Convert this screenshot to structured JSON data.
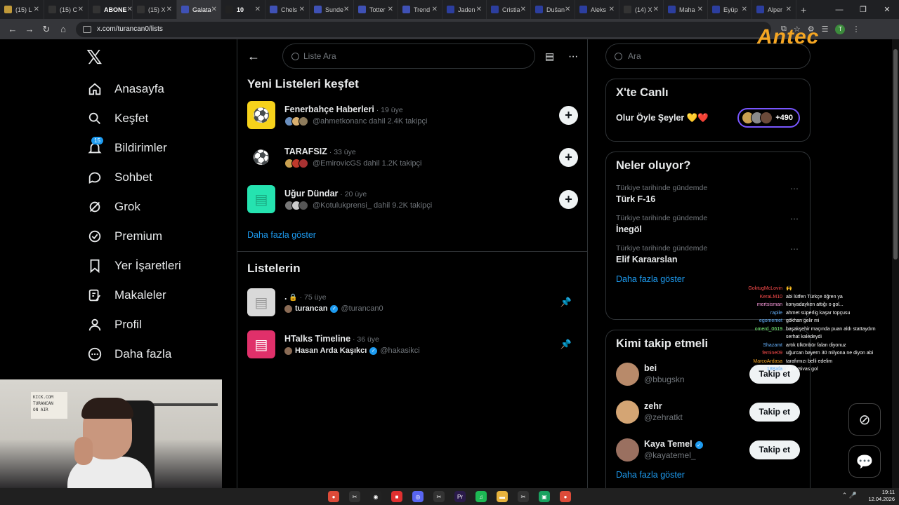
{
  "browser": {
    "tabs": [
      {
        "label": "(15) L",
        "color": "#c19a3a"
      },
      {
        "label": "(15) C",
        "color": "#333333"
      },
      {
        "label": "ABONE",
        "color": "#333333",
        "bold": true
      },
      {
        "label": "(15) X",
        "color": "#333333"
      },
      {
        "label": "Galata",
        "color": "#3f51b5"
      },
      {
        "label": "10",
        "color": "#222222",
        "bold": true
      },
      {
        "label": "Chels",
        "color": "#3f51b5"
      },
      {
        "label": "Sunde",
        "color": "#3f51b5"
      },
      {
        "label": "Totter",
        "color": "#3f51b5"
      },
      {
        "label": "Trend",
        "color": "#3f51b5"
      },
      {
        "label": "Jaden",
        "color": "#2c3e9e"
      },
      {
        "label": "Cristia",
        "color": "#2c3e9e"
      },
      {
        "label": "Dušan",
        "color": "#2c3e9e"
      },
      {
        "label": "Aleks",
        "color": "#2c3e9e"
      },
      {
        "label": "(14) X",
        "color": "#333333"
      },
      {
        "label": "Maha",
        "color": "#2c3e9e"
      },
      {
        "label": "Eyüp",
        "color": "#2c3e9e"
      },
      {
        "label": "Alper",
        "color": "#2c3e9e"
      }
    ],
    "url": "x.com/turancan0/lists"
  },
  "nav": {
    "items": [
      {
        "label": "Anasayfa",
        "icon": "home-icon"
      },
      {
        "label": "Keşfet",
        "icon": "search-icon"
      },
      {
        "label": "Bildirimler",
        "icon": "bell-icon",
        "badge": "15"
      },
      {
        "label": "Sohbet",
        "icon": "chat-icon"
      },
      {
        "label": "Grok",
        "icon": "grok-icon"
      },
      {
        "label": "Premium",
        "icon": "premium-icon"
      },
      {
        "label": "Yer İşaretleri",
        "icon": "bookmark-icon"
      },
      {
        "label": "Makaleler",
        "icon": "article-icon"
      },
      {
        "label": "Profil",
        "icon": "profile-icon"
      },
      {
        "label": "Daha fazla",
        "icon": "more-icon"
      }
    ]
  },
  "webcam": {
    "sign_text": "KICK.COM\nTURANCAN\nON AIR"
  },
  "middle": {
    "search_placeholder": "Liste Ara",
    "discover_title": "Yeni Listeleri keşfet",
    "discover": [
      {
        "name": "Fenerbahçe Haberleri",
        "meta": "· 19 üye",
        "follow": "@ahmetkonanc dahil 2.4K takipçi",
        "thumb_bg": "#f6d21b",
        "thumb_glyph": "⚽",
        "avs": [
          "#6a8fbf",
          "#d9b070",
          "#8d7b5c"
        ]
      },
      {
        "name": "TARAFSIZ",
        "meta": "· 33 üye",
        "follow": "@EmirovicGS dahil 1.2K takipçi",
        "thumb_bg": "#000000",
        "thumb_glyph": "⚽",
        "avs": [
          "#c9a050",
          "#c0392b",
          "#a83232"
        ]
      },
      {
        "name": "Uğur Dündar",
        "meta": "· 20 üye",
        "follow": "@Kotulukprensi_ dahil 9.2K takipçi",
        "thumb_bg": "#25e3b0",
        "thumb_glyph": "▤",
        "avs": [
          "#777777",
          "#cccccc",
          "#555555"
        ]
      }
    ],
    "show_more": "Daha fazla göster",
    "your_lists_title": "Listelerin",
    "lists": [
      {
        "name": ".",
        "locked": true,
        "meta": "· 75 üye",
        "owner": "turancan",
        "handle": "@turancan0",
        "thumb_bg": "#d9d9d9",
        "thumb_fg": "#999999"
      },
      {
        "name": "HTalks Timeline",
        "locked": false,
        "meta": "· 36 üye",
        "owner": "Hasan Arda Kaşıkcı",
        "handle": "@hakasikci",
        "thumb_bg": "#e0306a",
        "thumb_fg": "#ffffff"
      }
    ]
  },
  "right": {
    "search_placeholder": "Ara",
    "live_title": "X'te Canlı",
    "live_name": "Olur Öyle Şeyler 💛❤️",
    "live_count": "+490",
    "trends_title": "Neler oluyor?",
    "trends": [
      {
        "context": "Türkiye tarihinde gündemde",
        "name": "Türk F-16"
      },
      {
        "context": "Türkiye tarihinde gündemde",
        "name": "İnegöl"
      },
      {
        "context": "Türkiye tarihinde gündemde",
        "name": "Elif Karaarslan"
      }
    ],
    "trends_more": "Daha fazla göster",
    "who_title": "Kimi takip etmeli",
    "who": [
      {
        "name": "bei",
        "handle": "@bbugskn",
        "verified": false,
        "color": "#b88a6a"
      },
      {
        "name": "zehr",
        "handle": "@zehratkt",
        "verified": false,
        "color": "#d4a574"
      },
      {
        "name": "Kaya Temel",
        "handle": "@kayatemel_",
        "verified": true,
        "color": "#9a7060"
      }
    ],
    "follow_label": "Takip et",
    "who_more": "Daha fazla göster"
  },
  "overlay": {
    "logo": "Antec",
    "chat": [
      {
        "user": "GoktugMcLovin",
        "color": "#ff4d4d",
        "text": "🙌"
      },
      {
        "user": "KeraLM10",
        "color": "#ff4d4d",
        "text": "abi lütfen Türkçe öğren ya"
      },
      {
        "user": "mertsisman",
        "color": "#ff9de0",
        "text": "konyadayken attığı o gol..."
      },
      {
        "user": "rapile",
        "color": "#66b3ff",
        "text": "ahmet süperlig kaşar topçusu"
      },
      {
        "user": "egomemet",
        "color": "#66b3ff",
        "text": "gökhan gelir mi"
      },
      {
        "user": "omerd_0619",
        "color": "#7fff7f",
        "text": "başakşehir maçında puan aldı stattaydım"
      },
      {
        "user": "",
        "color": "#ffffff",
        "text": "serhat kaledeydi"
      },
      {
        "user": "Shazamt",
        "color": "#66b3ff",
        "text": "artık ülkönbür falan diyonuz"
      },
      {
        "user": "femine09",
        "color": "#ff4d4d",
        "text": "uğurcan bayern 30 milyona ne diyon abi"
      },
      {
        "user": "MarcoArdasa",
        "color": "#f5a623",
        "text": "tarafımızı belli edelim"
      },
      {
        "user": "18Bafa",
        "color": "#66b3ff",
        "text": "oğuz Sivas gol"
      }
    ]
  },
  "taskbar": {
    "time": "19:11",
    "date": "12.04.2026",
    "apps": [
      {
        "name": "chrome",
        "color": "#dd4b39",
        "glyph": "●"
      },
      {
        "name": "capcut",
        "color": "#333333",
        "glyph": "✂"
      },
      {
        "name": "obs",
        "color": "#222222",
        "glyph": "◉"
      },
      {
        "name": "stream",
        "color": "#e03030",
        "glyph": "■"
      },
      {
        "name": "discord",
        "color": "#5865f2",
        "glyph": "◎"
      },
      {
        "name": "capcut2",
        "color": "#333333",
        "glyph": "✂"
      },
      {
        "name": "premiere",
        "color": "#2a1a4a",
        "glyph": "Pr"
      },
      {
        "name": "spotify",
        "color": "#1db954",
        "glyph": "♫"
      },
      {
        "name": "explorer",
        "color": "#e8b33d",
        "glyph": "▬"
      },
      {
        "name": "capcut3",
        "color": "#333333",
        "glyph": "✂"
      },
      {
        "name": "app-green",
        "color": "#1aa260",
        "glyph": "▣"
      },
      {
        "name": "chrome2",
        "color": "#dd4b39",
        "glyph": "●"
      }
    ]
  }
}
